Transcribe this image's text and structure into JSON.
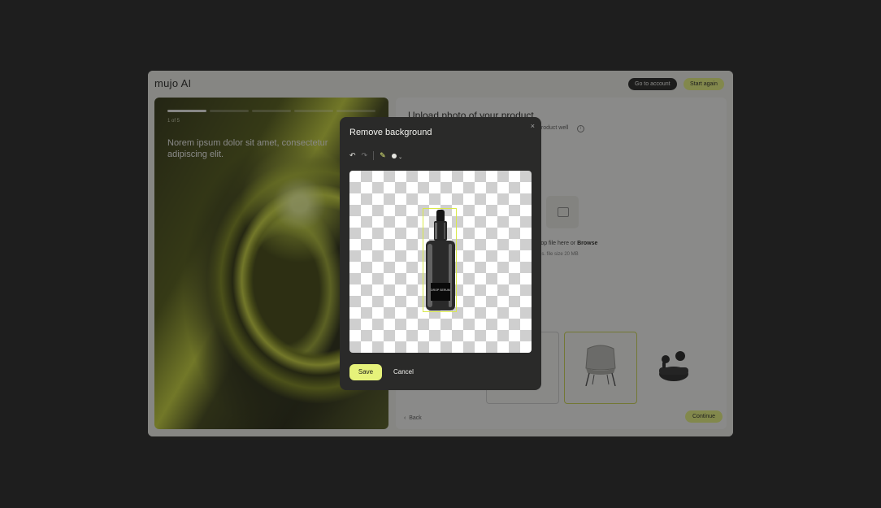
{
  "app": {
    "logo": "mujo AI",
    "go_to_account": "Go to account",
    "start_again": "Start again"
  },
  "left_panel": {
    "progress_segments": 5,
    "active_segment": 1,
    "step": "1 of 5",
    "hero_text": "Norem ipsum dolor sit amet, consectetur adipiscing elit."
  },
  "right_panel": {
    "title": "Upload photo of your product",
    "subtitle": "product well",
    "drop_text_prefix": "rop file here or ",
    "drop_browse": "Browse",
    "drop_size": "es. file size 20 MB",
    "back": "Back",
    "continue": "Continue"
  },
  "modal": {
    "title": "Remove background",
    "close": "×",
    "save": "Save",
    "cancel": "Cancel",
    "bottle_label": "DROP SERUM"
  }
}
